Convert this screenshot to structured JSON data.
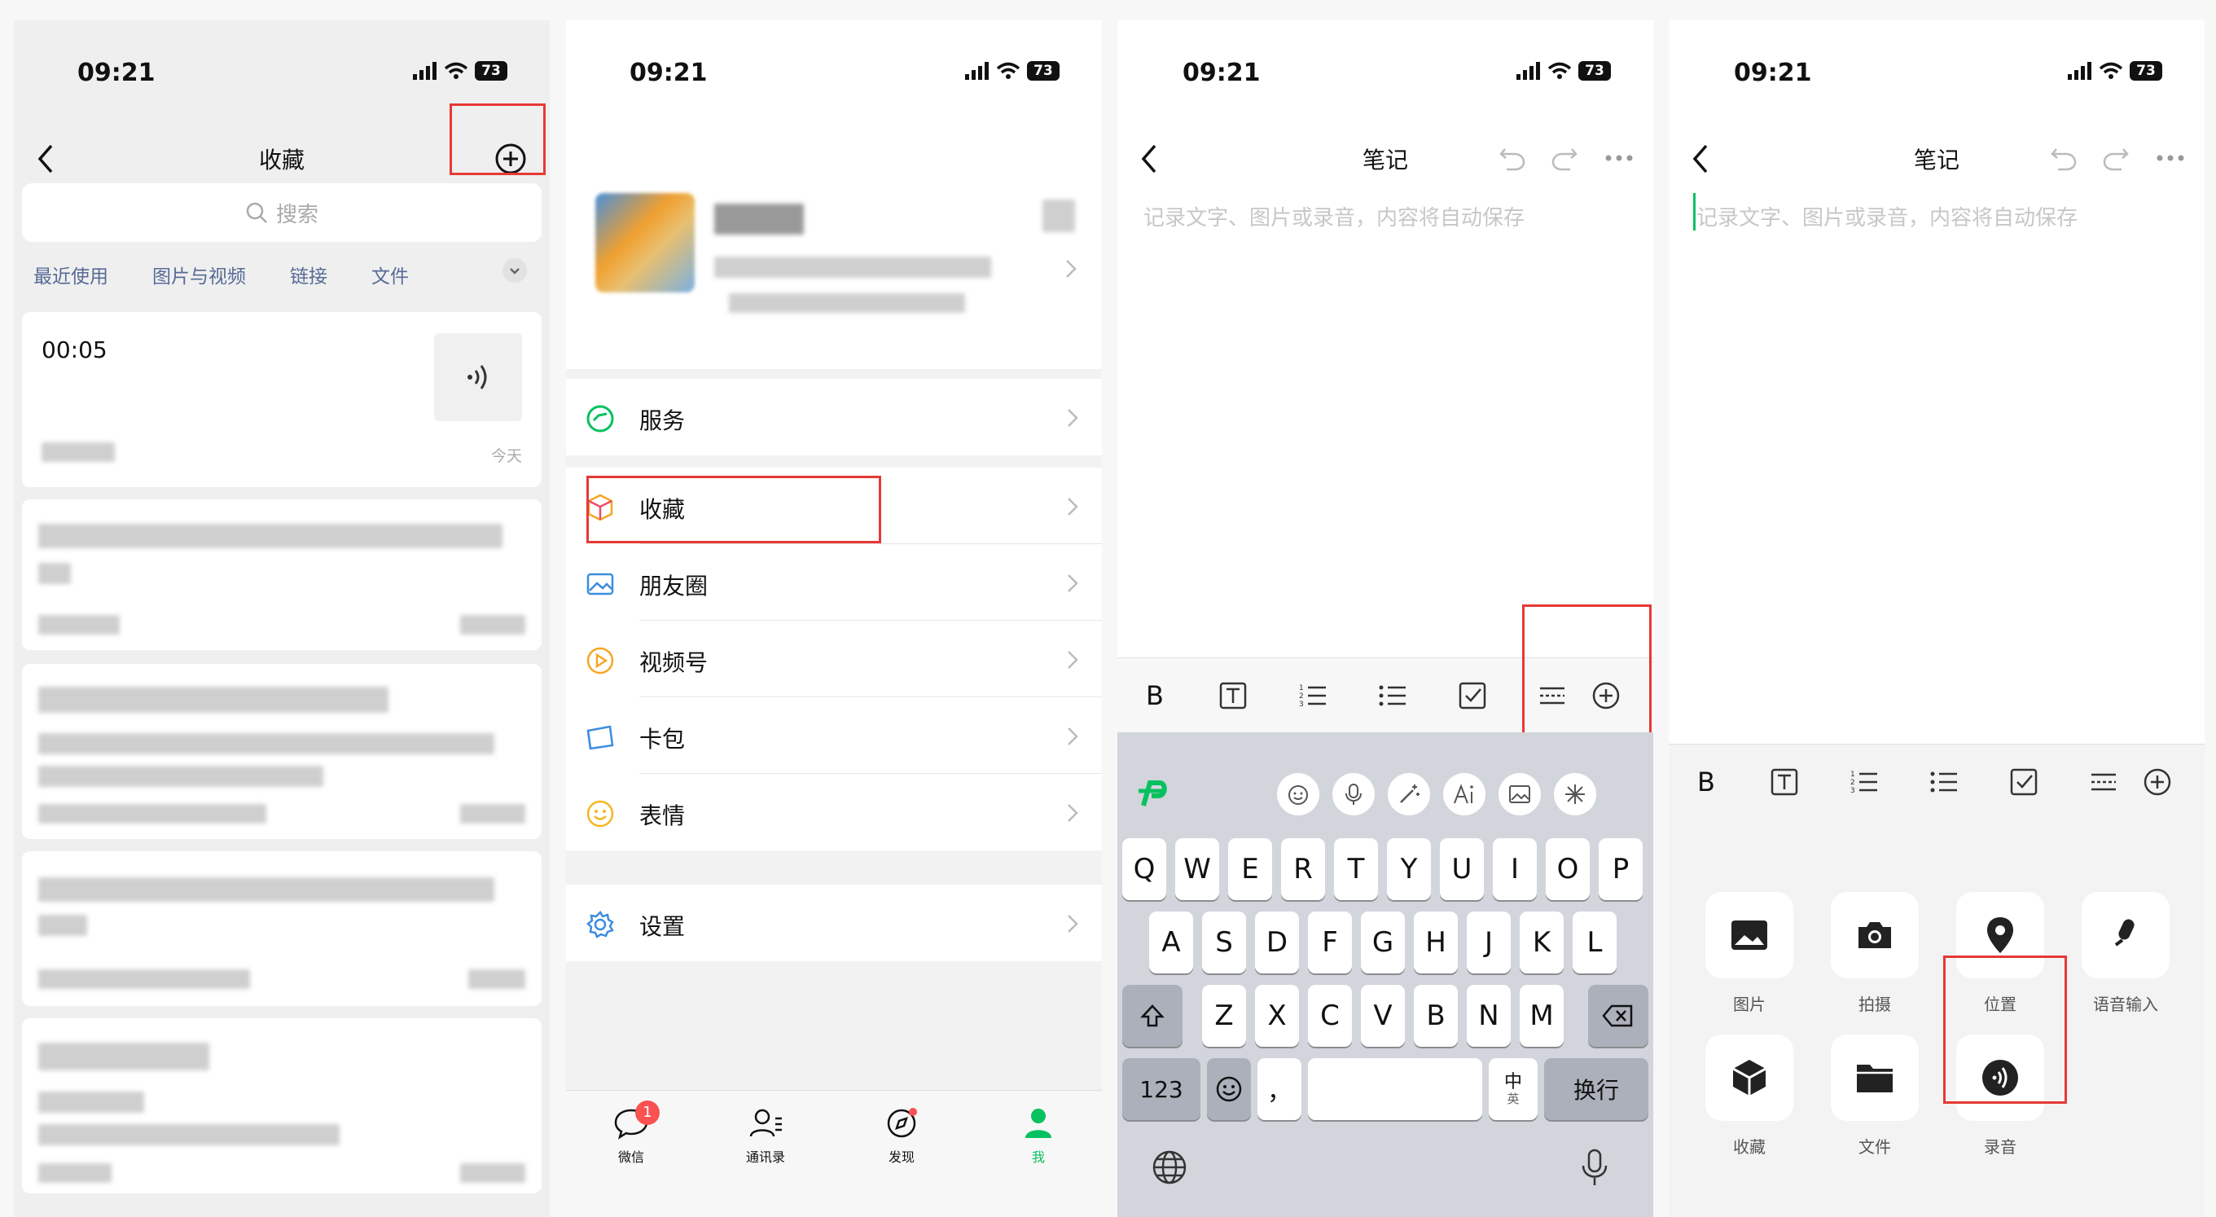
{
  "status": {
    "time": "09:21",
    "battery": "73"
  },
  "screen1": {
    "title": "收藏",
    "search_placeholder": "搜索",
    "filters": [
      "最近使用",
      "图片与视频",
      "链接",
      "文件"
    ],
    "voice_card": {
      "duration": "00:05",
      "date": "今天"
    }
  },
  "screen2": {
    "menu": [
      "服务",
      "收藏",
      "朋友圈",
      "视频号",
      "卡包",
      "表情",
      "设置"
    ],
    "tabs": [
      "微信",
      "通讯录",
      "发现",
      "我"
    ],
    "badge": "1"
  },
  "screen3": {
    "title": "笔记",
    "placeholder": "记录文字、图片或录音，内容将自动保存",
    "toolbar_bold": "B",
    "keyboard": {
      "row1": [
        "Q",
        "W",
        "E",
        "R",
        "T",
        "Y",
        "U",
        "I",
        "O",
        "P"
      ],
      "row2": [
        "A",
        "S",
        "D",
        "F",
        "G",
        "H",
        "J",
        "K",
        "L"
      ],
      "row3": [
        "Z",
        "X",
        "C",
        "V",
        "B",
        "N",
        "M"
      ],
      "num_key": "123",
      "punct_key": "，",
      "lang_key": "中",
      "lang_sub": "英",
      "return_key": "换行"
    }
  },
  "screen4": {
    "title": "笔记",
    "placeholder": "记录文字、图片或录音，内容将自动保存",
    "toolbar_bold": "B",
    "grid": [
      "图片",
      "拍摄",
      "位置",
      "语音输入",
      "收藏",
      "文件",
      "录音"
    ]
  },
  "colors": {
    "accent": "#07c160",
    "link": "#576b95",
    "highlight": "#e53935"
  }
}
